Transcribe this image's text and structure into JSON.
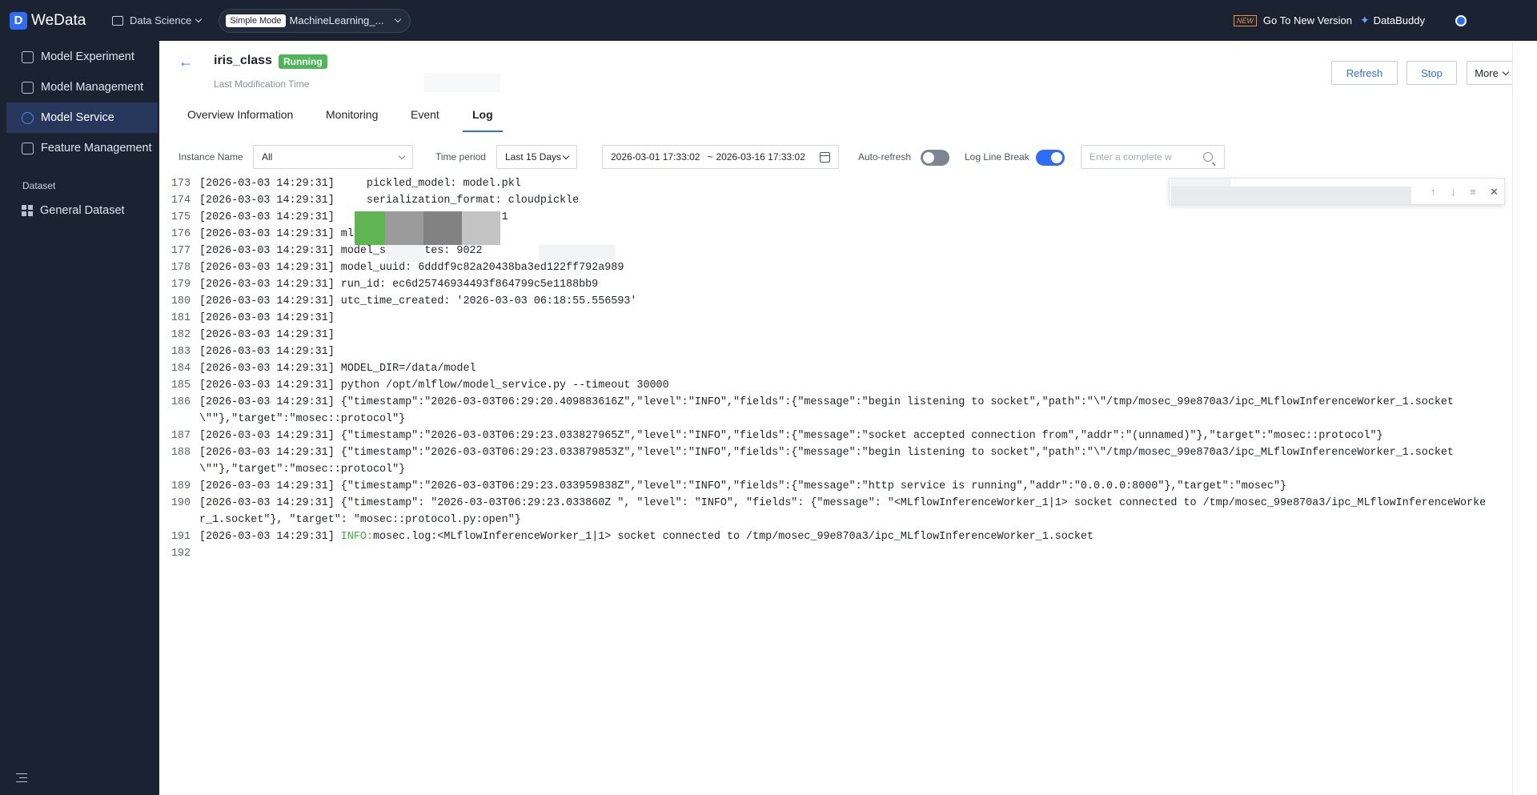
{
  "topbar": {
    "logo_mark": "D",
    "logo_text": "WeData",
    "workspace": "Data Science",
    "mode_tag": "Simple Mode",
    "project_name": "MachineLearning_...",
    "new_badge": "NEW",
    "new_version": "Go To New Version",
    "spark": "✦",
    "buddy": "DataBuddy"
  },
  "sidebar": {
    "items": [
      {
        "label": "Model Experiment",
        "icon": "experiment-icon"
      },
      {
        "label": "Model Management",
        "icon": "model-icon"
      },
      {
        "label": "Model Service",
        "icon": "service-icon"
      },
      {
        "label": "Feature Management",
        "icon": "feature-icon"
      }
    ],
    "section": "Dataset",
    "dataset_item": "General Dataset"
  },
  "header": {
    "back": "←",
    "title": "iris_class",
    "status": "Running",
    "mod_time_label": "Last Modification Time",
    "refresh": "Refresh",
    "stop": "Stop",
    "more": "More"
  },
  "tabs": [
    "Overview Information",
    "Monitoring",
    "Event",
    "Log"
  ],
  "filters": {
    "instance_label": "Instance Name",
    "instance_value": "All",
    "period_label": "Time period",
    "period_value": "Last 15 Days",
    "date_start": "2026-03-01 17:33:02",
    "date_sep": "~",
    "date_end": "2026-03-16 17:33:02",
    "auto_refresh_label": "Auto-refresh",
    "log_break_label": "Log Line Break",
    "search_placeholder": "Enter a complete w"
  },
  "log": [
    {
      "n": "173",
      "t": "[2026-03-03 14:29:31]     pickled_model: model.pkl"
    },
    {
      "n": "174",
      "t": "[2026-03-03 14:29:31]     serialization_format: cloudpickle"
    },
    {
      "n": "175",
      "t": "[2026-03-03 14:29:31]     sklearn_version: 1.6.1"
    },
    {
      "n": "176",
      "t": "[2026-03-03 14:29:31] mlflow_version: 2.17.2"
    },
    {
      "n": "177",
      "t": "[2026-03-03 14:29:31] model_size_bytes: 9022"
    },
    {
      "n": "178",
      "t": "[2026-03-03 14:29:31] model_uuid: 6dddf9c82a20438ba3ed122ff792a989"
    },
    {
      "n": "179",
      "t": "[2026-03-03 14:29:31] run_id: ec6d25746934493f864799c5e1188bb9"
    },
    {
      "n": "180",
      "t": "[2026-03-03 14:29:31] utc_time_created: '2026-03-03 06:18:55.556593'"
    },
    {
      "n": "181",
      "t": "[2026-03-03 14:29:31]"
    },
    {
      "n": "182",
      "t": "[2026-03-03 14:29:31]"
    },
    {
      "n": "183",
      "t": "[2026-03-03 14:29:31]"
    },
    {
      "n": "184",
      "t": "[2026-03-03 14:29:31] MODEL_DIR=/data/model"
    },
    {
      "n": "185",
      "t": "[2026-03-03 14:29:31] python /opt/mlflow/model_service.py --timeout 30000"
    },
    {
      "n": "186",
      "t": "[2026-03-03 14:29:31] {\"timestamp\":\"2026-03-03T06:29:20.409883616Z\",\"level\":\"INFO\",\"fields\":{\"message\":\"begin listening to socket\",\"path\":\"\\\"/tmp/mosec_99e870a3/ipc_MLflowInferenceWorker_1.socket\\\"\"},\"target\":\"mosec::protocol\"}"
    },
    {
      "n": "187",
      "t": "[2026-03-03 14:29:31] {\"timestamp\":\"2026-03-03T06:29:23.033827965Z\",\"level\":\"INFO\",\"fields\":{\"message\":\"socket accepted connection from\",\"addr\":\"(unnamed)\"},\"target\":\"mosec::protocol\"}"
    },
    {
      "n": "188",
      "t": "[2026-03-03 14:29:31] {\"timestamp\":\"2026-03-03T06:29:23.033879853Z\",\"level\":\"INFO\",\"fields\":{\"message\":\"begin listening to socket\",\"path\":\"\\\"/tmp/mosec_99e870a3/ipc_MLflowInferenceWorker_1.socket\\\"\"},\"target\":\"mosec::protocol\"}"
    },
    {
      "n": "189",
      "t": "[2026-03-03 14:29:31] {\"timestamp\":\"2026-03-03T06:29:23.033959838Z\",\"level\":\"INFO\",\"fields\":{\"message\":\"http service is running\",\"addr\":\"0.0.0.0:8000\"},\"target\":\"mosec\"}"
    },
    {
      "n": "190",
      "t": "[2026-03-03 14:29:31] {\"timestamp\": \"2026-03-03T06:29:23.033860Z \", \"level\": \"INFO\", \"fields\": {\"message\": \"<MLflowInferenceWorker_1|1> socket connected to /tmp/mosec_99e870a3/ipc_MLflowInferenceWorker_1.socket\"}, \"target\": \"mosec::protocol.py:open\"}"
    },
    {
      "n": "191",
      "t": "[2026-03-03 14:29:31] ",
      "info": "INFO:",
      "rest": "mosec.log:<MLflowInferenceWorker_1|1> socket connected to /tmp/mosec_99e870a3/ipc_MLflowInferenceWorker_1.socket"
    },
    {
      "n": "192",
      "t": ""
    }
  ],
  "find": {
    "up": "↑",
    "down": "↓",
    "wrap": "≡",
    "close": "✕"
  },
  "colors": {
    "accent": "#2e6cf6",
    "running": "#4fb55a",
    "topbar": "#1b2333",
    "info": "#3fae3f"
  }
}
